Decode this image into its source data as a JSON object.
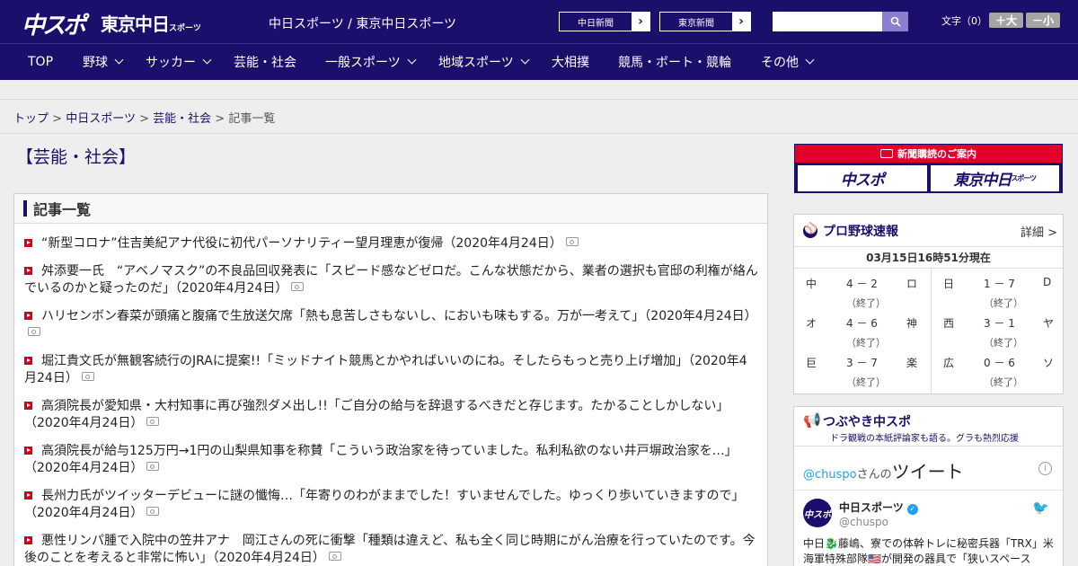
{
  "header": {
    "logo_chuspo": "中スポ",
    "logo_tokyo": "東京中日",
    "logo_tokyo_small": "スポーツ",
    "site_link": "中日スポーツ / 東京中日スポーツ",
    "paper1": "中日新聞",
    "paper2": "東京新聞",
    "search_placeholder": "",
    "font_label": "文字（0）",
    "font_plus": "＋大",
    "font_minus": "－小"
  },
  "nav": [
    "TOP",
    "野球",
    "サッカー",
    "芸能・社会",
    "一般スポーツ",
    "地域スポーツ",
    "大相撲",
    "競馬・ボート・競輪",
    "その他"
  ],
  "breadcrumb": {
    "top": "トップ",
    "sep": ">",
    "chunichi": "中日スポーツ",
    "category": "芸能・社会",
    "current": "記事一覧"
  },
  "page_title": "【芸能・社会】",
  "panel_title": "記事一覧",
  "articles": [
    "“新型コロナ”住吉美紀アナ代役に初代パーソナリティー望月理恵が復帰（2020年4月24日）",
    "舛添要一氏　“アベノマスク”の不良品回収発表に「スピード感などゼロだ。こんな状態だから、業者の選択も官邸の利権が絡んでいるのかと疑ったのだ」（2020年4月24日）",
    "ハリセンボン春菜が頭痛と腹痛で生放送欠席「熱も息苦しさもないし、においも味もする。万が一考えて」（2020年4月24日）",
    "堀江貴文氏が無観客続行のJRAに提案!!「ミッドナイト競馬とかやればいいのにね。そしたらもっと売り上げ増加」（2020年4月24日）",
    "高須院長が愛知県・大村知事に再び強烈ダメ出し!!「ご自分の給与を辞退するべきだと存じます。たかることしかしない」（2020年4月24日）",
    "高須院長が給与125万円→1円の山梨県知事を称賛「こういう政治家を待っていました。私利私欲のない井戸塀政治家を…」（2020年4月24日）",
    "長州力氏がツイッターデビューに謎の懺悔…「年寄りのわがままでした！すいませんでした。ゆっくり歩いていきますので」（2020年4月24日）",
    "悪性リンパ腫で入院中の笠井アナ　岡江さんの死に衝撃「種類は違えど、私も全く同じ時期にがん治療を行っていたのです。今後のことを考えると非常に怖い」（2020年4月24日）"
  ],
  "subscribe": {
    "head": "新聞購読のご案内",
    "logo1": "中スポ",
    "logo2": "東京中日",
    "logo2_small": "スポーツ"
  },
  "baseball": {
    "title": "プロ野球速報",
    "detail": "詳細 >",
    "time": "03月15日16時51分現在",
    "games_left": [
      {
        "home": "中",
        "score": "4 － 2",
        "away": "ロ",
        "status": "（終了）"
      },
      {
        "home": "オ",
        "score": "4 － 6",
        "away": "神",
        "status": "（終了）"
      },
      {
        "home": "巨",
        "score": "3 － 7",
        "away": "楽",
        "status": "（終了）"
      }
    ],
    "games_right": [
      {
        "home": "日",
        "score": "1 － 7",
        "away": "D",
        "status": "（終了）"
      },
      {
        "home": "西",
        "score": "3 － 1",
        "away": "ヤ",
        "status": "（終了）"
      },
      {
        "home": "広",
        "score": "0 － 6",
        "away": "ソ",
        "status": "（終了）"
      }
    ]
  },
  "tweets": {
    "title": "つぶやき中スポ",
    "subtitle": "ドラ観戦の本紙評論家も語る。グラも熱烈応援",
    "handle_prefix": "@chuspo",
    "handle_suffix": "さんの",
    "tweet_word": "ツイート",
    "account_name": "中日スポーツ",
    "account_handle": "@chuspo",
    "text": "中日🐉藤嶋、寮での体幹トレに秘密兵器「TRX」米海軍特殊部隊🇺🇸が開発の器具で「狭いスペース"
  }
}
